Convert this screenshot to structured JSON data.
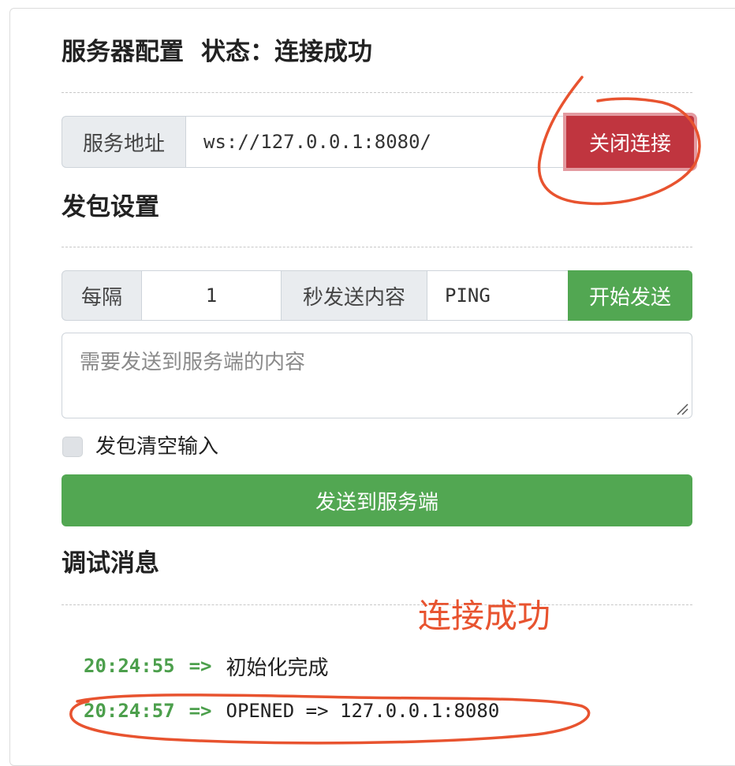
{
  "server_config": {
    "title": "服务器配置",
    "status_label": "状态：",
    "status_value": "连接成功",
    "address_label": "服务地址",
    "address_value": "ws://127.0.0.1:8080/",
    "close_button": "关闭连接"
  },
  "packet_settings": {
    "title": "发包设置",
    "interval_label": "每隔",
    "interval_value": "1",
    "content_label": "秒发送内容",
    "content_value": "PING",
    "start_button": "开始发送",
    "message_placeholder": "需要发送到服务端的内容",
    "clear_checkbox_label": "发包清空输入",
    "clear_checkbox_checked": false,
    "send_button": "发送到服务端"
  },
  "debug": {
    "title": "调试消息",
    "logs": [
      {
        "time": "20:24:55",
        "arrow": "=>",
        "message": "初始化完成"
      },
      {
        "time": "20:24:57",
        "arrow": "=>",
        "message": "OPENED => 127.0.0.1:8080"
      }
    ]
  },
  "annotation": {
    "text": "连接成功",
    "color": "#e8532f"
  },
  "colors": {
    "success": "#52a752",
    "danger": "#c0353f",
    "log_time": "#4c9f4c"
  }
}
